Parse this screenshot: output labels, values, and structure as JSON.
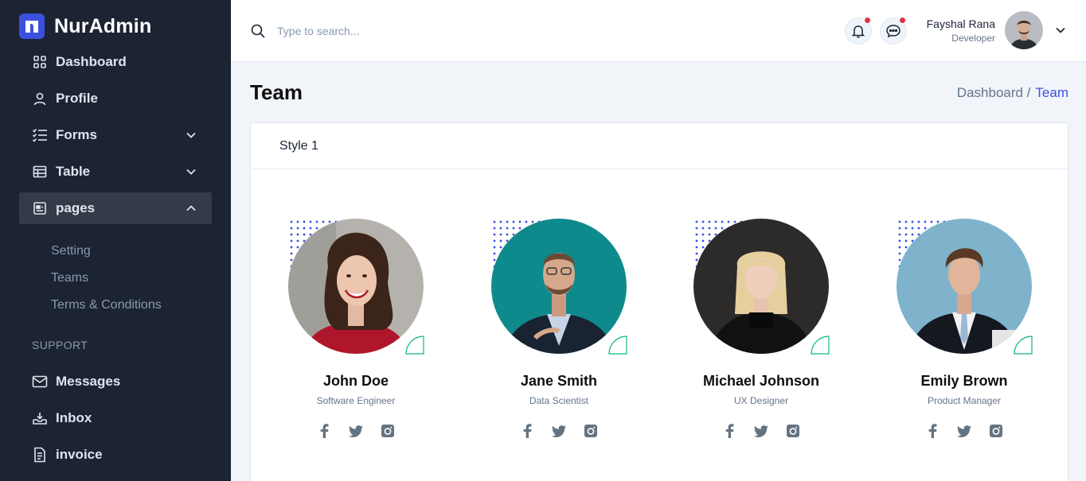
{
  "brand": {
    "name": "NurAdmin"
  },
  "sidebar": {
    "items": [
      {
        "label": "Dashboard",
        "icon": "grid-icon"
      },
      {
        "label": "Profile",
        "icon": "user-icon"
      },
      {
        "label": "Forms",
        "icon": "list-check-icon",
        "expandable": true
      },
      {
        "label": "Table",
        "icon": "table-icon",
        "expandable": true
      },
      {
        "label": "pages",
        "icon": "page-icon",
        "expandable": true,
        "expanded": true
      }
    ],
    "sub_items": [
      "Setting",
      "Teams",
      "Terms & Conditions"
    ],
    "section_label": "SUPPORT",
    "support_items": [
      {
        "label": "Messages",
        "icon": "mail-icon"
      },
      {
        "label": "Inbox",
        "icon": "inbox-icon"
      },
      {
        "label": "invoice",
        "icon": "invoice-icon"
      }
    ]
  },
  "header": {
    "search_placeholder": "Type to search...",
    "user": {
      "name": "Fayshal Rana",
      "role": "Developer"
    }
  },
  "page": {
    "title": "Team",
    "breadcrumb": {
      "parent": "Dashboard /",
      "current": "Team"
    }
  },
  "card": {
    "title": "Style 1",
    "members": [
      {
        "name": "John Doe",
        "role": "Software Engineer",
        "photo_bg": "#b5b2ad"
      },
      {
        "name": "Jane Smith",
        "role": "Data Scientist",
        "photo_bg": "#0f8a8c"
      },
      {
        "name": "Michael Johnson",
        "role": "UX Designer",
        "photo_bg": "#2d2b29"
      },
      {
        "name": "Emily Brown",
        "role": "Product Manager",
        "photo_bg": "#7fb3cc"
      }
    ]
  },
  "colors": {
    "sidebar": "#1c2434",
    "accent": "#3c50e0",
    "teal_accent": "#10b981",
    "notify": "#dc3545"
  }
}
